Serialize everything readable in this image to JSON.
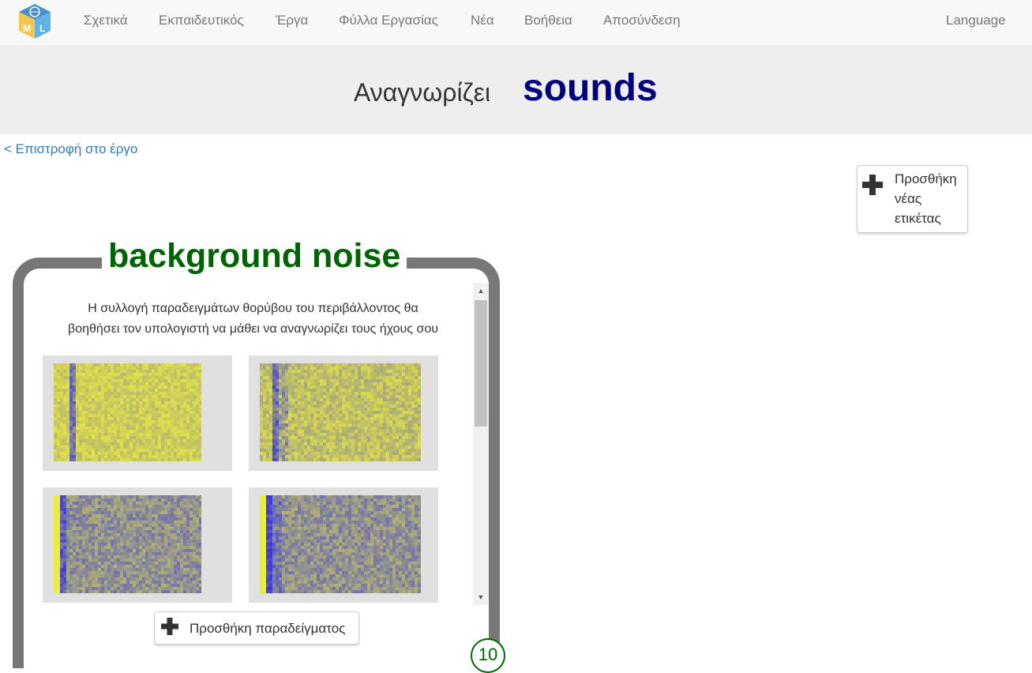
{
  "nav": {
    "logo_letters": [
      "M",
      "L"
    ],
    "items": [
      "Σχετικά",
      "Εκπαιδευτικός",
      "Έργα",
      "Φύλλα Εργασίας",
      "Νέα",
      "Βοήθεια",
      "Αποσύνδεση"
    ],
    "language": "Language"
  },
  "header": {
    "recognises": "Αναγνωρίζει",
    "project_name": "sounds"
  },
  "back_link": "< Επιστροφή στο έργο",
  "add_label": {
    "lines": [
      "Προσθήκη",
      "νέας",
      "ετικέτας"
    ],
    "icon": "plus-icon"
  },
  "bucket": {
    "title": "background noise",
    "description_lines": [
      "Η συλλογή παραδειγμάτων θορύβου του περιβάλλοντος θα",
      "βοηθήσει τον υπολογιστή να μάθει να αναγνωρίζει τους ήχους σου"
    ],
    "add_example": "Προσθήκη παραδείγματος",
    "count": "10",
    "spectrogram_colors": {
      "high": "#f0f03c",
      "low": "#3c3cdc",
      "tile_bg": "#e0e0e0"
    }
  },
  "colors": {
    "title_green": "#006400",
    "project_navy": "#000080",
    "link_blue": "#337ab7",
    "bucket_border": "#777777"
  }
}
